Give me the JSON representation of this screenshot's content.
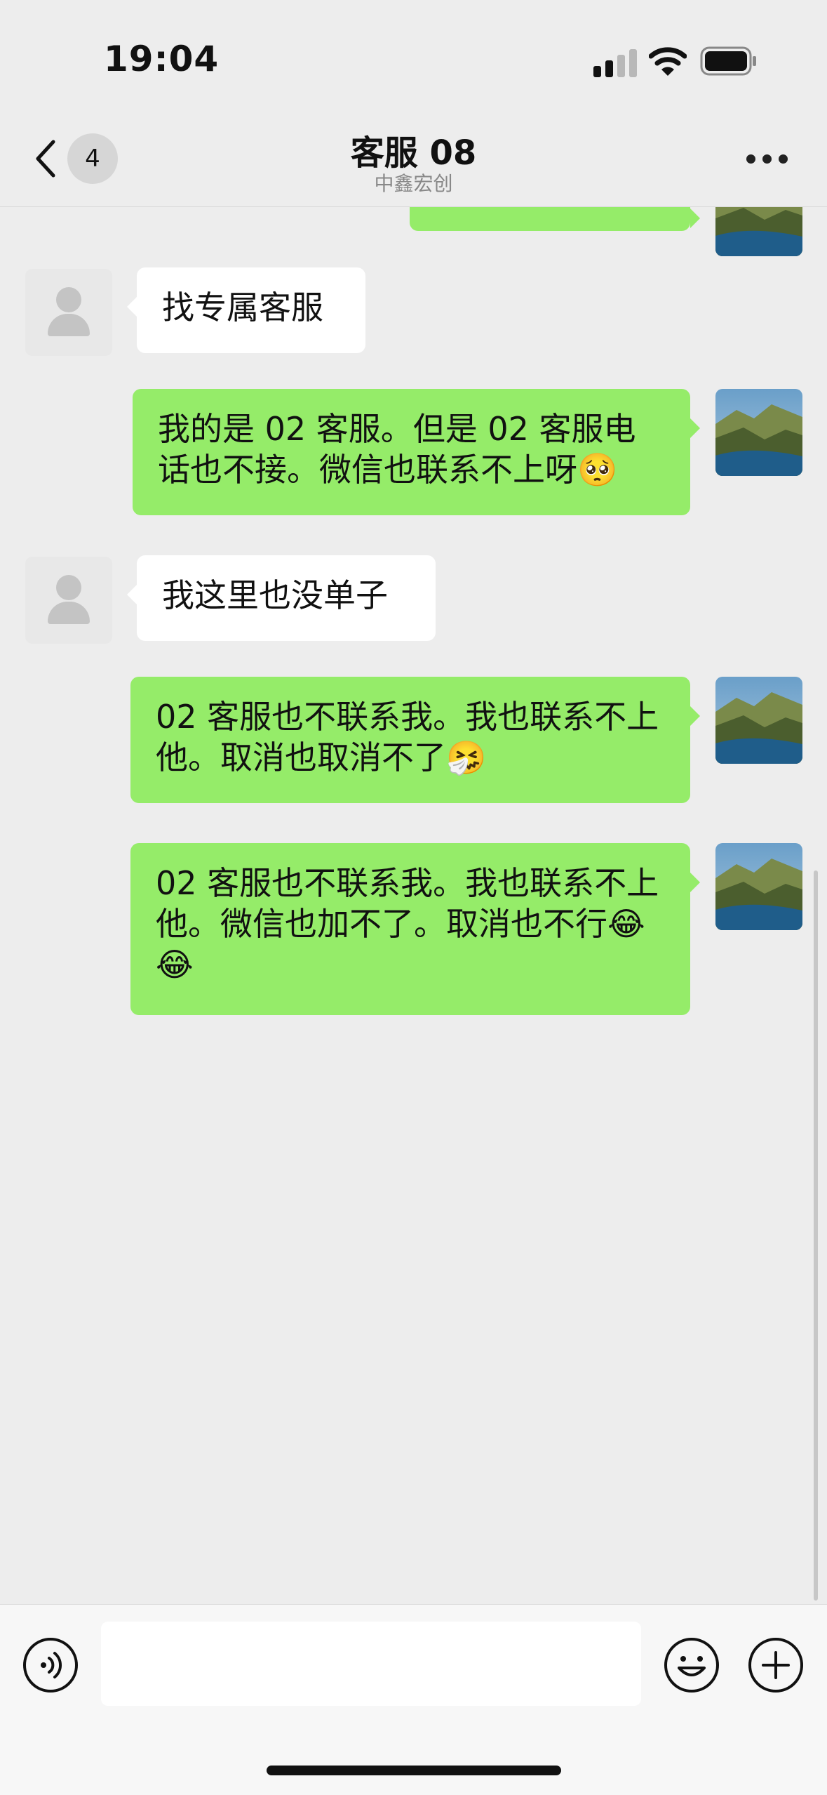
{
  "status": {
    "time": "19:04"
  },
  "header": {
    "unread_count": "4",
    "title": "客服 08",
    "subtitle": "中鑫宏创",
    "icons": [
      "back-chevron-icon",
      "more-dots-icon"
    ]
  },
  "messages": [
    {
      "from": "me",
      "text": ""
    },
    {
      "from": "other",
      "text": "找专属客服"
    },
    {
      "from": "me",
      "text": "我的是 02 客服。但是 02 客服电话也不接。微信也联系不上呀🥺"
    },
    {
      "from": "other",
      "text": "我这里也没单子"
    },
    {
      "from": "me",
      "text": "02 客服也不联系我。我也联系不上他。取消也取消不了🤧"
    },
    {
      "from": "me",
      "text": "02 客服也不联系我。我也联系不上他。微信也加不了。取消也不行😂😂"
    }
  ],
  "input": {
    "value": "",
    "icons": [
      "voice-icon",
      "emoji-icon",
      "plus-icon"
    ]
  },
  "colors": {
    "background": "#ededed",
    "outgoing_bubble": "#95ec69",
    "incoming_bubble": "#ffffff"
  }
}
